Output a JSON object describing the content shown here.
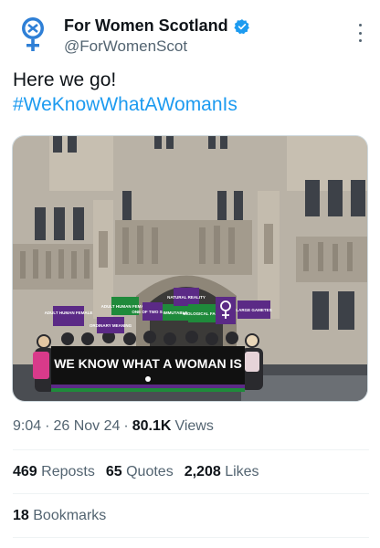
{
  "account": {
    "display_name": "For Women Scotland",
    "handle": "@ForWomenScot",
    "verified_icon": "verified-badge-icon",
    "avatar_icon": "venus-symbol-icon"
  },
  "tweet": {
    "text_line1": "Here we go!",
    "hashtag": "#WeKnowWhatAWomanIs"
  },
  "media": {
    "banner_text": "WE KNOW WHAT A WOMAN IS",
    "placards": [
      "ADULT HUMAN FEMALE",
      "ADULT HUMAN FEMALE",
      "ONE OF TWO SEXES",
      "IMMUTABLE",
      "NATURAL REALITY",
      "BIOLOGICAL FACT",
      "ORDINARY MEANING",
      "LARGE GAMETES"
    ]
  },
  "meta": {
    "time": "9:04",
    "sep1": "·",
    "date": "26 Nov 24",
    "sep2": "·",
    "views_count": "80.1K",
    "views_label": "Views"
  },
  "stats": {
    "reposts_count": "469",
    "reposts_label": "Reposts",
    "quotes_count": "65",
    "quotes_label": "Quotes",
    "likes_count": "2,208",
    "likes_label": "Likes",
    "bookmarks_count": "18",
    "bookmarks_label": "Bookmarks"
  },
  "colors": {
    "accent": "#1d9bf0",
    "secondary_text": "#536471",
    "banner_bg": "#111111",
    "placard_purple": "#5b2a86",
    "placard_green": "#1f8a3b"
  }
}
